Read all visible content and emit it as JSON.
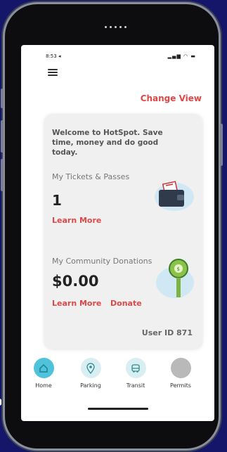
{
  "status_bar": {
    "time": "8:53 ◂",
    "indicators": "▂▄▆ ◠ ▬"
  },
  "header": {
    "menu_icon": "hamburger-icon",
    "change_view_label": "Change View"
  },
  "card": {
    "welcome_text": "Welcome to HotSpot. Save time, money and do good today.",
    "tickets": {
      "title": "My Tickets & Passes",
      "count": "1",
      "learn_more": "Learn More",
      "icon": "ticket-wallet-icon"
    },
    "donations": {
      "title": "My Community Donations",
      "amount": "$0.00",
      "learn_more": "Learn More",
      "donate": "Donate",
      "icon": "parking-meter-icon"
    },
    "user_id": "User ID 871"
  },
  "tabs": [
    {
      "label": "Home",
      "icon": "home-icon",
      "color": "#4fc3d9",
      "active": true
    },
    {
      "label": "Parking",
      "icon": "parking-pin-icon",
      "color": "#d8eef2",
      "active": false
    },
    {
      "label": "Transit",
      "icon": "bus-icon",
      "color": "#d8eef2",
      "active": false
    },
    {
      "label": "Permits",
      "icon": "permit-icon",
      "color": "#b9b9b9",
      "active": false
    }
  ],
  "colors": {
    "accent": "#e04747",
    "background": "#15166a",
    "home_tab": "#4fc3d9"
  }
}
